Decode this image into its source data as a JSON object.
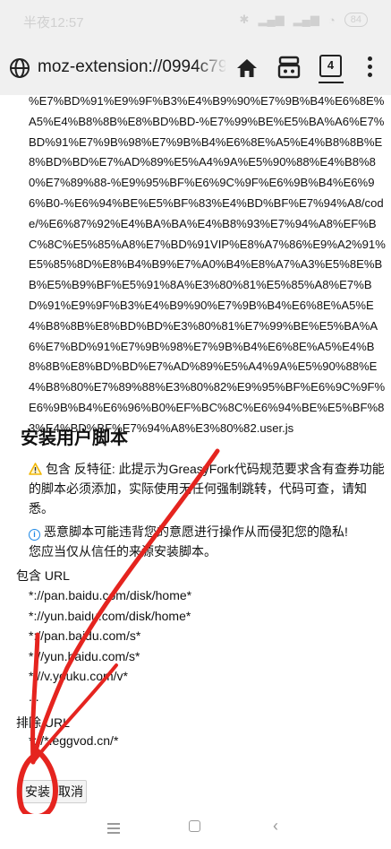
{
  "status_bar": {
    "time": "半夜12:57",
    "battery": "84"
  },
  "browser": {
    "url_main": "moz-extension://0994c79",
    "url_faded": "2",
    "tab_count": "4"
  },
  "page": {
    "encoded_text": "%E7%BD%91%E9%9F%B3%E4%B9%90%E7%9B%B4%E6%8E%A5%E4%B8%8B%E8%BD%BD-%E7%99%BE%E5%BA%A6%E7%BD%91%E7%9B%98%E7%9B%B4%E6%8E%A5%E4%B8%8B%E8%BD%BD%E7%AD%89%E5%A4%9A%E5%90%88%E4%B8%80%E7%89%88-%E9%95%BF%E6%9C%9F%E6%9B%B4%E6%96%B0-%E6%94%BE%E5%BF%83%E4%BD%BF%E7%94%A8/code/%E6%87%92%E4%BA%BA%E4%B8%93%E7%94%A8%EF%BC%8C%E5%85%A8%E7%BD%91VIP%E8%A7%86%E9%A2%91%E5%85%8D%E8%B4%B9%E7%A0%B4%E8%A7%A3%E5%8E%BB%E5%B9%BF%E5%91%8A%E3%80%81%E5%85%A8%E7%BD%91%E9%9F%B3%E4%B9%90%E7%9B%B4%E6%8E%A5%E4%B8%8B%E8%BD%BD%E3%80%81%E7%99%BE%E5%BA%A6%E7%BD%91%E7%9B%98%E7%9B%B4%E6%8E%A5%E4%B8%8B%E8%BD%BD%E7%AD%89%E5%A4%9A%E5%90%88%E4%B8%80%E7%89%88%E3%80%82%E9%95%BF%E6%9C%9F%E6%9B%B4%E6%96%B0%EF%BC%8C%E6%94%BE%E5%BF%83%E4%BD%BF%E7%94%A8%E3%80%82.user.js",
    "section_title": "安装用户脚本",
    "warning": "包含 反特征: 此提示为GreasyFork代码规范要求含有查券功能的脚本必须添加，实际使用无任何强制跳转，代码可查，请知悉。",
    "info_line1": "恶意脚本可能违背您的意愿进行操作从而侵犯您的隐私!",
    "info_line2": "您应当仅从信任的来源安装脚本。",
    "include_label": "包含 URL",
    "include_urls": [
      "*://pan.baidu.com/disk/home*",
      "*://yun.baidu.com/disk/home*",
      "*://pan.baidu.com/s*",
      "*://yun.baidu.com/s*",
      "*://v.youku.com/v*",
      "..."
    ],
    "exclude_label": "排除 URL",
    "exclude_url": "*://*.eggvod.cn/*",
    "install_button": "安装",
    "cancel_button": "取消"
  },
  "colors": {
    "annotation_red": "#e5241f",
    "info_blue": "#1e88e5",
    "warning_yellow": "#f2b807",
    "chrome_gray": "#f0f0f0"
  }
}
